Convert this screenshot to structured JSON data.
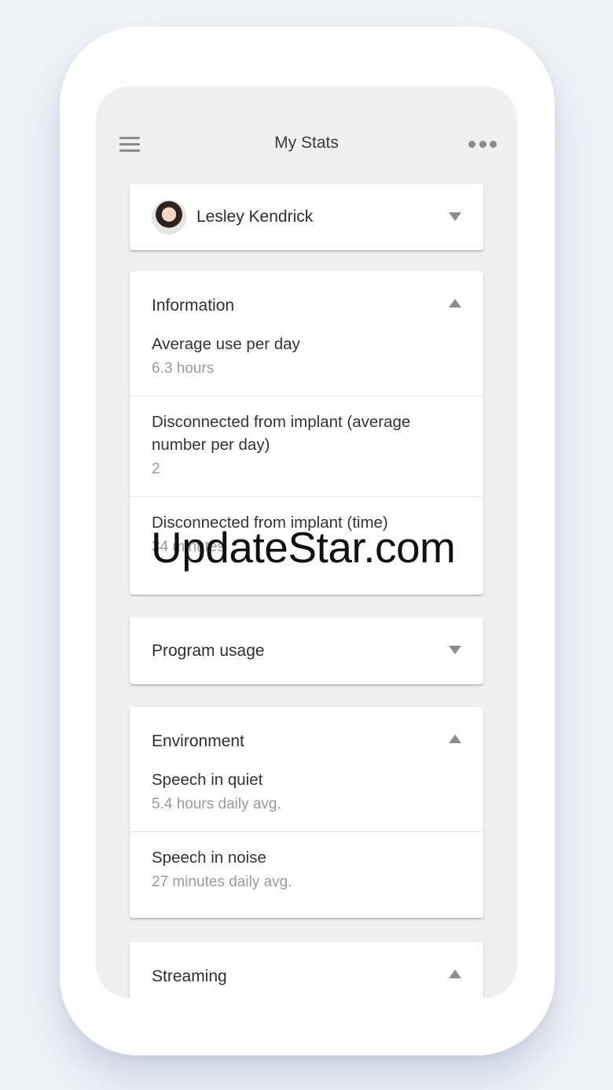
{
  "header": {
    "title": "My Stats"
  },
  "profile": {
    "name": "Lesley Kendrick"
  },
  "information": {
    "heading": "Information",
    "rows": [
      {
        "label": "Average use per day",
        "value": "6.3 hours"
      },
      {
        "label": "Disconnected from implant (average number per day)",
        "value": "2"
      },
      {
        "label": "Disconnected from implant (time)",
        "value": "34 minutes"
      }
    ]
  },
  "program_usage": {
    "heading": "Program usage"
  },
  "environment": {
    "heading": "Environment",
    "rows": [
      {
        "label": "Speech in quiet",
        "value": "5.4 hours daily avg."
      },
      {
        "label": "Speech in noise",
        "value": "27 minutes daily avg."
      }
    ]
  },
  "streaming": {
    "heading": "Streaming"
  },
  "watermark": "UpdateStar.com",
  "colors": {
    "background": "#f0f2f6",
    "screen": "#efefef",
    "card": "#ffffff",
    "icon": "#8a8a8a"
  }
}
